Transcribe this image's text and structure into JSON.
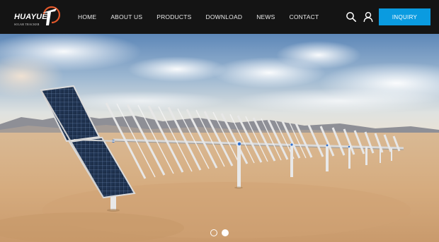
{
  "brand": {
    "name": "HUAYUE",
    "tagline": "SOLAR TRACKER",
    "accent_color": "#e2582b"
  },
  "nav": {
    "items": [
      {
        "label": "HOME"
      },
      {
        "label": "ABOUT US"
      },
      {
        "label": "PRODUCTS"
      },
      {
        "label": "DOWNLOAD"
      },
      {
        "label": "NEWS"
      },
      {
        "label": "CONTACT"
      }
    ]
  },
  "header": {
    "search_icon": "search-icon",
    "user_icon": "user-icon",
    "inquiry_label": "INQUIRY",
    "inquiry_color": "#0a9be0"
  },
  "hero": {
    "image": "solar-tracker-desert-banner",
    "slides_total": 2,
    "active_slide": 2
  }
}
